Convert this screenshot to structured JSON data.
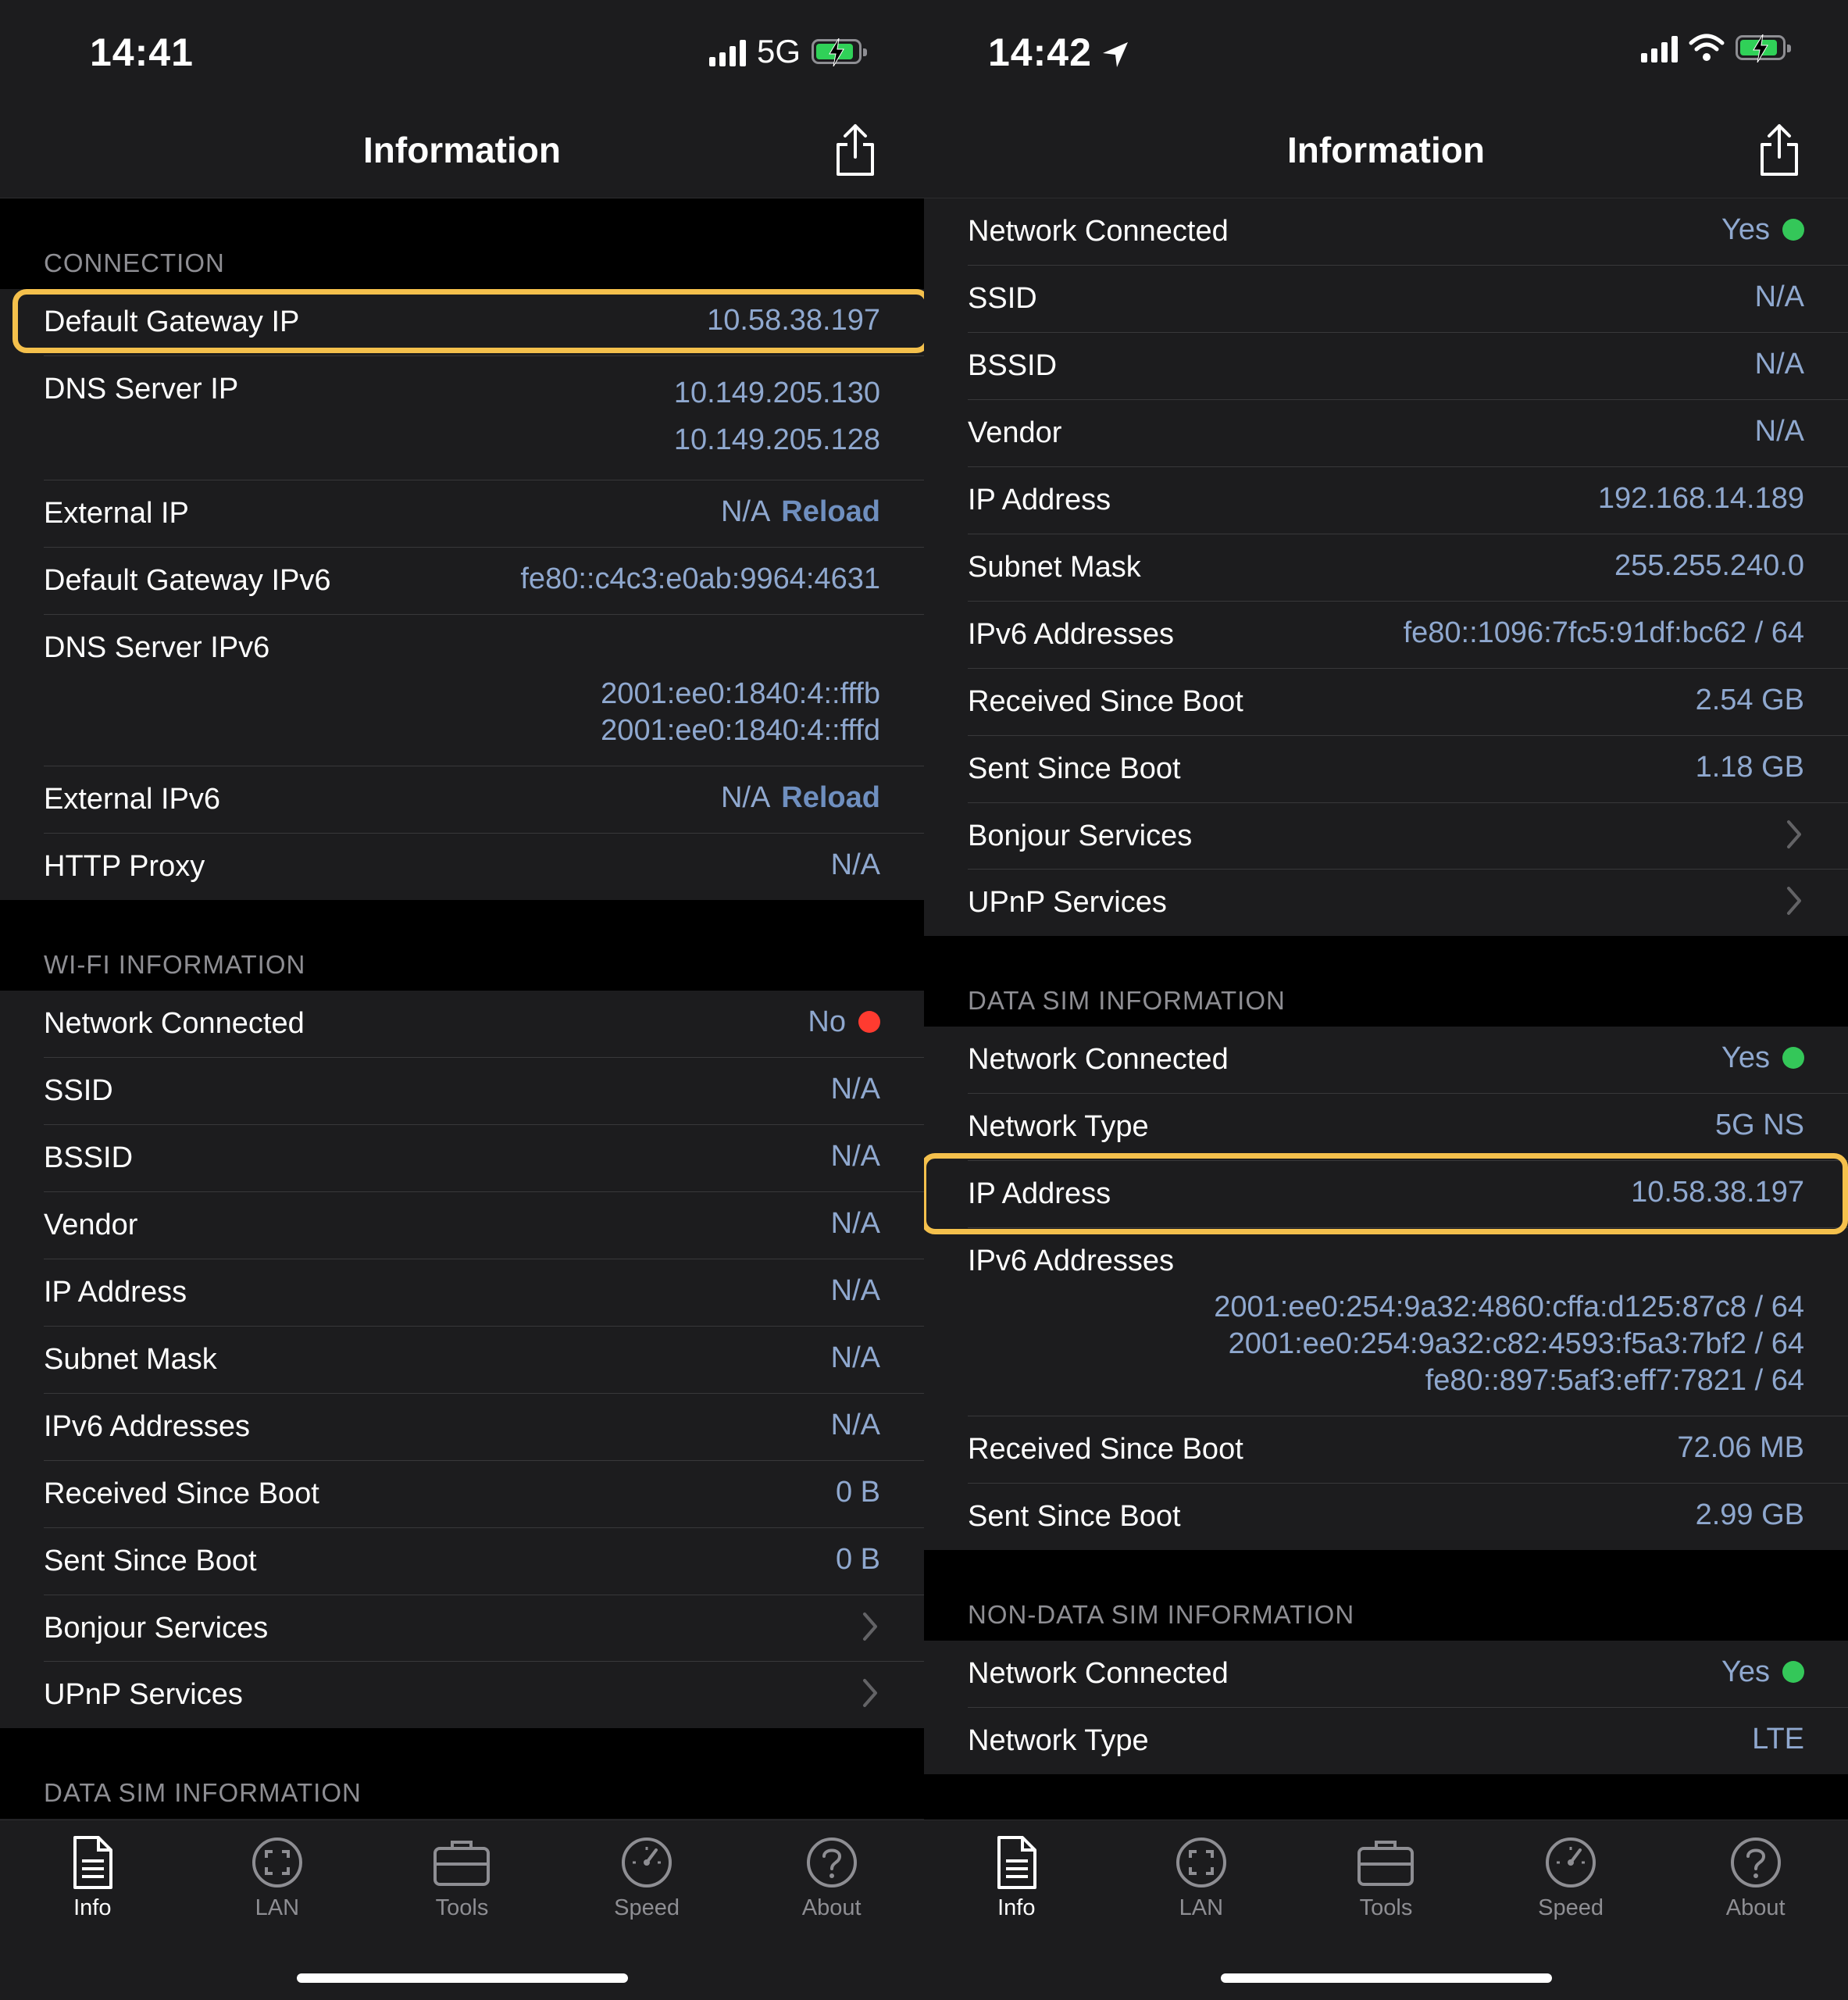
{
  "left": {
    "time": "14:41",
    "carrier": "5G",
    "title": "Information",
    "sections": [
      {
        "header": "CONNECTION",
        "rows": [
          {
            "label": "Default Gateway IP",
            "value": "10.58.38.197"
          },
          {
            "label": "DNS Server IP",
            "value1": "10.149.205.130",
            "value2": "10.149.205.128"
          },
          {
            "label": "External IP",
            "value": "N/A",
            "action": "Reload"
          },
          {
            "label": "Default Gateway IPv6",
            "value": "fe80::c4c3:e0ab:9964:4631"
          },
          {
            "label": "DNS Server IPv6",
            "value1": "2001:ee0:1840:4::fffb",
            "value2": "2001:ee0:1840:4::fffd"
          },
          {
            "label": "External IPv6",
            "value": "N/A",
            "action": "Reload"
          },
          {
            "label": "HTTP Proxy",
            "value": "N/A"
          }
        ]
      },
      {
        "header": "WI-FI INFORMATION",
        "rows": [
          {
            "label": "Network Connected",
            "value": "No",
            "status_color": "#ff3b30"
          },
          {
            "label": "SSID",
            "value": "N/A"
          },
          {
            "label": "BSSID",
            "value": "N/A"
          },
          {
            "label": "Vendor",
            "value": "N/A"
          },
          {
            "label": "IP Address",
            "value": "N/A"
          },
          {
            "label": "Subnet Mask",
            "value": "N/A"
          },
          {
            "label": "IPv6 Addresses",
            "value": "N/A"
          },
          {
            "label": "Received Since Boot",
            "value": "0 B"
          },
          {
            "label": "Sent Since Boot",
            "value": "0 B"
          },
          {
            "label": "Bonjour Services"
          },
          {
            "label": "UPnP Services"
          }
        ]
      },
      {
        "header": "DATA SIM INFORMATION"
      }
    ]
  },
  "right": {
    "time": "14:42",
    "title": "Information",
    "wifi_rows": [
      {
        "label": "Network Connected",
        "value": "Yes",
        "status_color": "#34c759"
      },
      {
        "label": "SSID",
        "value": "N/A"
      },
      {
        "label": "BSSID",
        "value": "N/A"
      },
      {
        "label": "Vendor",
        "value": "N/A"
      },
      {
        "label": "IP Address",
        "value": "192.168.14.189"
      },
      {
        "label": "Subnet Mask",
        "value": "255.255.240.0"
      },
      {
        "label": "IPv6 Addresses",
        "value": "fe80::1096:7fc5:91df:bc62 / 64"
      },
      {
        "label": "Received Since Boot",
        "value": "2.54 GB"
      },
      {
        "label": "Sent Since Boot",
        "value": "1.18 GB"
      },
      {
        "label": "Bonjour Services"
      },
      {
        "label": "UPnP Services"
      }
    ],
    "data_sim": {
      "header": "DATA SIM INFORMATION",
      "rows": [
        {
          "label": "Network Connected",
          "value": "Yes",
          "status_color": "#34c759"
        },
        {
          "label": "Network Type",
          "value": "5G NS"
        },
        {
          "label": "IP Address",
          "value": "10.58.38.197"
        },
        {
          "label": "IPv6 Addresses",
          "value1": "2001:ee0:254:9a32:4860:cffa:d125:87c8 / 64",
          "value2": "2001:ee0:254:9a32:c82:4593:f5a3:7bf2 / 64",
          "value3": "fe80::897:5af3:eff7:7821 / 64"
        },
        {
          "label": "Received Since Boot",
          "value": "72.06 MB"
        },
        {
          "label": "Sent Since Boot",
          "value": "2.99 GB"
        }
      ]
    },
    "non_data_sim": {
      "header": "NON-DATA SIM INFORMATION",
      "rows": [
        {
          "label": "Network Connected",
          "value": "Yes",
          "status_color": "#34c759"
        },
        {
          "label": "Network Type",
          "value": "LTE"
        }
      ]
    }
  },
  "tabs": [
    {
      "label": "Info",
      "icon": "document-icon",
      "active": true
    },
    {
      "label": "LAN",
      "icon": "lan-icon",
      "active": false
    },
    {
      "label": "Tools",
      "icon": "toolbox-icon",
      "active": false
    },
    {
      "label": "Speed",
      "icon": "speedometer-icon",
      "active": false
    },
    {
      "label": "About",
      "icon": "question-icon",
      "active": false
    }
  ],
  "colors": {
    "highlight": "#f4c04c",
    "value_text": "#8fa8cf",
    "background": "#1c1c1e",
    "battery": "#30d158"
  }
}
